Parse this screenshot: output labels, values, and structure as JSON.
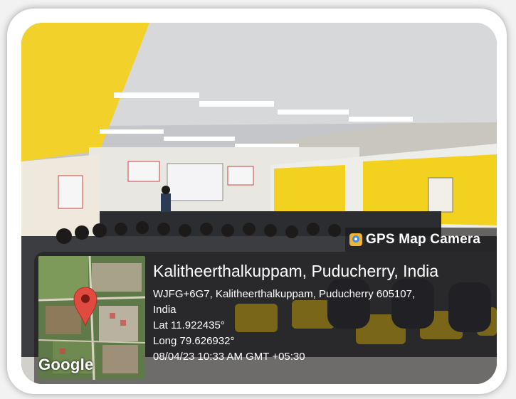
{
  "photo": {
    "description_icon": "classroom-photo"
  },
  "overlay": {
    "brand_title": "GPS Map Camera",
    "brand_icon": "gps-map-camera-icon",
    "location_title": "Kalitheerthalkuppam, Puducherry, India",
    "address_line_1": "WJFG+6G7, Kalitheerthalkuppam, Puducherry 605107,",
    "address_line_2": "India",
    "latitude": "Lat 11.922435°",
    "longitude": "Long 79.626932°",
    "datetime": "08/04/23 10:33 AM GMT +05:30",
    "map_logo": "Google",
    "pin_color": "#e04a3f"
  }
}
